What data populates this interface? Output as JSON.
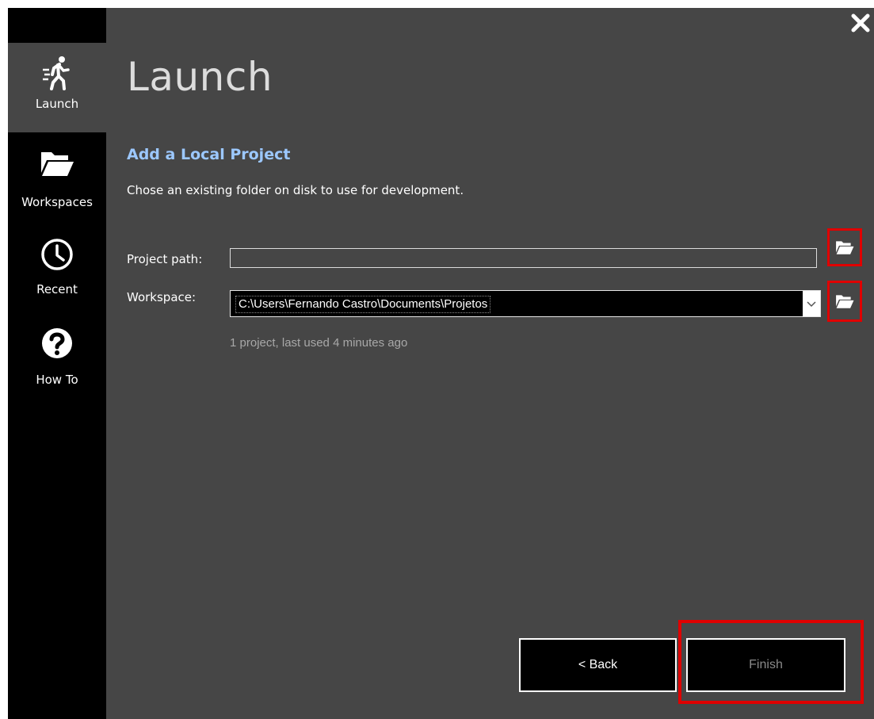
{
  "window": {
    "close_icon": "close-icon"
  },
  "sidebar": {
    "items": [
      {
        "label": "Launch",
        "icon": "running-person-icon",
        "active": true
      },
      {
        "label": "Workspaces",
        "icon": "folder-open-icon",
        "active": false
      },
      {
        "label": "Recent",
        "icon": "clock-icon",
        "active": false
      },
      {
        "label": "How To",
        "icon": "help-icon",
        "active": false
      }
    ]
  },
  "main": {
    "title": "Launch",
    "section_title": "Add a Local Project",
    "description": "Chose an existing folder on disk to use for development.",
    "project_path": {
      "label": "Project path:",
      "value": ""
    },
    "workspace": {
      "label": "Workspace:",
      "value": "C:\\Users\\Fernando Castro\\Documents\\Projetos",
      "info": "1 project, last used 4 minutes ago"
    },
    "buttons": {
      "back_label": "< Back",
      "finish_label": "Finish"
    }
  },
  "colors": {
    "sidebar_bg": "#000000",
    "content_bg": "#464646",
    "accent_blue": "#9cc8ff",
    "highlight_red": "#e00000",
    "muted_text": "#a8a8a8"
  }
}
